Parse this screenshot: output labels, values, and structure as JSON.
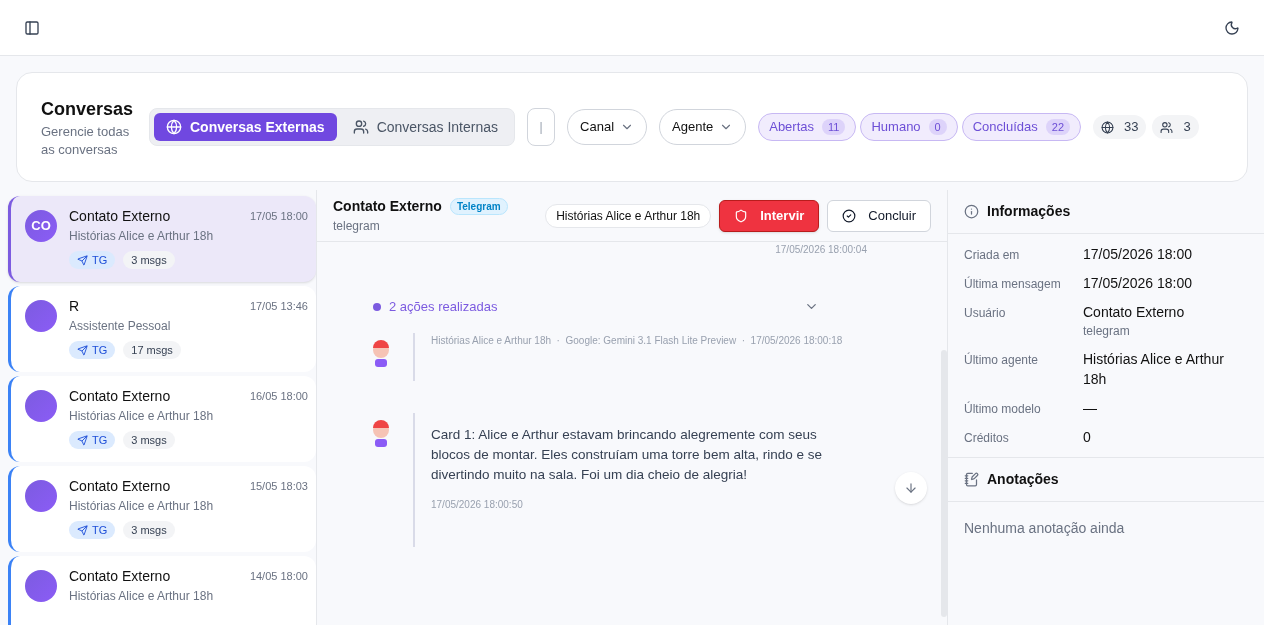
{
  "header": {
    "title": "Conversas",
    "subtitle": "Gerencie todas as conversas",
    "tabs": [
      {
        "label": "Conversas Externas",
        "selected": true
      },
      {
        "label": "Conversas Internas",
        "selected": false
      }
    ],
    "search": {
      "placeholder": "|"
    },
    "dropdowns": [
      "Canal",
      "Agente"
    ],
    "filters": [
      {
        "label": "Abertas",
        "count": "11"
      },
      {
        "label": "Humano",
        "count": "0"
      },
      {
        "label": "Concluídas",
        "count": "22"
      }
    ],
    "stats": [
      {
        "value": "33"
      },
      {
        "value": "3"
      }
    ]
  },
  "conversations": [
    {
      "name": "Contato Externo",
      "initials": "CO",
      "time": "17/05 18:00",
      "agent": "Histórias Alice e Arthur 18h",
      "channel": "TG",
      "messages": "3 msgs",
      "selected": true
    },
    {
      "name": "R",
      "time": "17/05 13:46",
      "agent": "Assistente Pessoal",
      "channel": "TG",
      "messages": "17 msgs",
      "selected": false
    },
    {
      "name": "Contato Externo",
      "time": "16/05 18:00",
      "agent": "Histórias Alice e Arthur 18h",
      "channel": "TG",
      "messages": "3 msgs",
      "selected": false
    },
    {
      "name": "Contato Externo",
      "time": "15/05 18:03",
      "agent": "Histórias Alice e Arthur 18h",
      "channel": "TG",
      "messages": "3 msgs",
      "selected": false
    },
    {
      "name": "Contato Externo",
      "time": "14/05 18:00",
      "agent": "Histórias Alice e Arthur 18h",
      "selected": false
    }
  ],
  "chat": {
    "name": "Contato Externo",
    "badge": "Telegram",
    "channel": "telegram",
    "agent": "Histórias Alice e Arthur 18h",
    "intervene": "Intervir",
    "conclude": "Concluir",
    "top_time": "17/05/2026 18:00:04",
    "actions": {
      "label": "2 ações realizadas",
      "expanded": false
    },
    "messages": [
      {
        "meta": "Histórias Alice e Arthur 18h  ·  Google: Gemini 3.1 Flash Lite Preview  ·  17/05/2026 18:00:18"
      },
      {
        "text": "Card 1: Alice e Arthur estavam brincando alegremente com seus blocos de montar. Eles construíam uma torre bem alta, rindo e se divertindo muito na sala. Foi um dia cheio de alegria!",
        "time": "17/05/2026 18:00:50"
      }
    ]
  },
  "info": {
    "title": "Informações",
    "rows": [
      {
        "label": "Criada em",
        "value": "17/05/2026 18:00"
      },
      {
        "label": "Última mensagem",
        "value": "17/05/2026 18:00"
      },
      {
        "label": "Usuário",
        "value": "Contato Externo",
        "sub": "telegram"
      },
      {
        "label": "Último agente",
        "value": "Histórias Alice e Arthur 18h"
      },
      {
        "label": "Último modelo",
        "value": "—"
      },
      {
        "label": "Créditos",
        "value": "0"
      }
    ],
    "notes_title": "Anotações",
    "notes_empty": "Nenhuma anotação ainda"
  }
}
